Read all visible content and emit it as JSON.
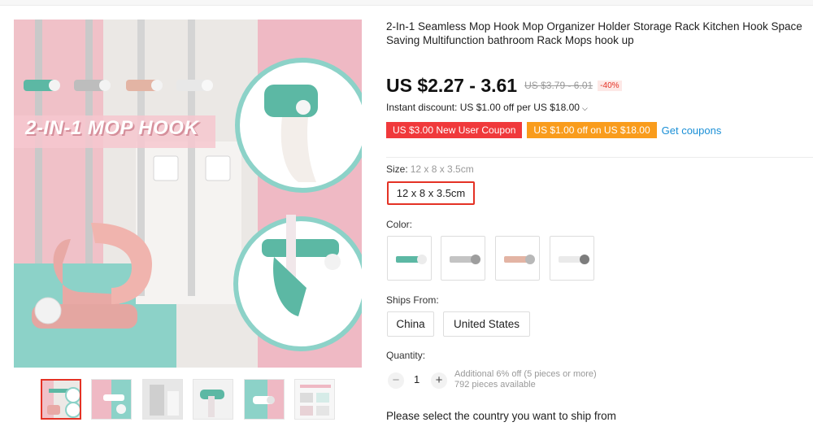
{
  "product": {
    "title": "2-In-1 Seamless Mop Hook Mop Organizer Holder Storage Rack Kitchen Hook Space Saving Multifunction bathroom Rack Mops hook up",
    "image_overlay_text": "2-IN-1 MOP HOOK",
    "price": "US $2.27 - 3.61",
    "original_price": "US $3.79 - 6.01",
    "discount_pct": "-40%",
    "instant_discount": "Instant discount: US $1.00 off per US $18.00",
    "coupons": {
      "new_user": "US $3.00 New User Coupon",
      "store": "US $1.00 off on US $18.00",
      "get": "Get coupons"
    }
  },
  "size": {
    "label": "Size:",
    "selected": "12 x 8 x 3.5cm",
    "options": [
      "12 x 8 x 3.5cm"
    ]
  },
  "color": {
    "label": "Color:",
    "options": [
      {
        "name": "swatch-green",
        "color": "#5cb8a4"
      },
      {
        "name": "swatch-grey",
        "color": "#b9b9b9"
      },
      {
        "name": "swatch-pink",
        "color": "#e3b4a4"
      },
      {
        "name": "swatch-white",
        "color": "#e6e6e6"
      }
    ]
  },
  "ships_from": {
    "label": "Ships From:",
    "options": [
      "China",
      "United States"
    ]
  },
  "quantity": {
    "label": "Quantity:",
    "value": "1",
    "minus": "−",
    "plus": "+",
    "bulk_note": "Additional 6% off (5 pieces or more)",
    "available": "792 pieces available"
  },
  "ship_message": "Please select the country you want to ship from",
  "thumbnails": 6,
  "colors": {
    "accent": "#e43225",
    "coupon_red": "#f0393b",
    "coupon_orange": "#f99c1c",
    "link": "#1a8fd6",
    "teal": "#5cb8a4",
    "pink": "#efb9c4"
  }
}
